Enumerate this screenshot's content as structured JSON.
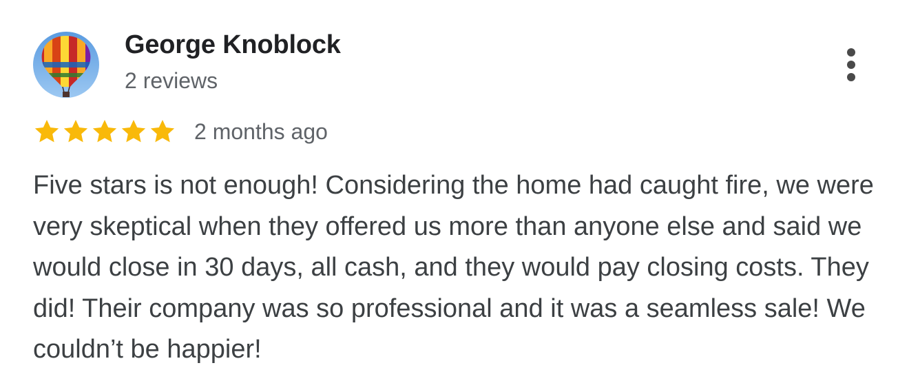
{
  "review": {
    "author_name": "George Knoblock",
    "review_count": "2 reviews",
    "rating": 5,
    "rating_max": 5,
    "timestamp": "2 months ago",
    "text": "Five stars is not enough! Considering the home had caught fire, we were very skeptical when they offered us more than anyone else and said we would close in 30 days, all cash, and they would pay closing costs. They did! Their company was so professional and it was a seamless sale! We couldn’t be happier!",
    "avatar_icon": "hot-air-balloon-icon",
    "menu_icon": "more-vert-icon"
  },
  "colors": {
    "star": "#F9B90A",
    "name": "#202124",
    "secondary_text": "#5f6368",
    "body_text": "#3c4043"
  }
}
